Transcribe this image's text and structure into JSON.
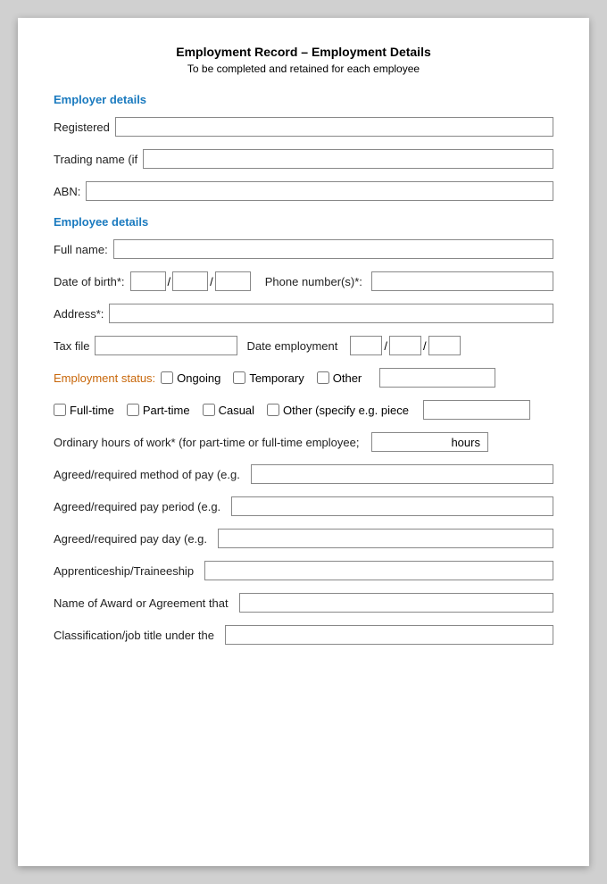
{
  "page": {
    "title": "Employment Record – Employment Details",
    "subtitle": "To be completed and retained for each employee"
  },
  "employer": {
    "heading": "Employer details",
    "registered_label": "Registered",
    "trading_label": "Trading name (if",
    "abn_label": "ABN:"
  },
  "employee": {
    "heading": "Employee details",
    "fullname_label": "Full name:",
    "dob_label": "Date of birth*:",
    "phone_label": "Phone number(s)*:",
    "address_label": "Address*:",
    "tax_label": "Tax file",
    "date_emp_label": "Date employment",
    "emp_status_label": "Employment status:",
    "ongoing_label": "Ongoing",
    "temporary_label": "Temporary",
    "other_status_label": "Other",
    "fulltime_label": "Full-time",
    "parttime_label": "Part-time",
    "casual_label": "Casual",
    "other_type_label": "Other (specify e.g. piece",
    "hours_label": "Ordinary hours of work* (for part-time or full-time employee;",
    "hours_unit": "hours",
    "pay_method_label": "Agreed/required method of pay (e.g.",
    "pay_period_label": "Agreed/required pay period (e.g.",
    "pay_day_label": "Agreed/required pay day (e.g.",
    "apprenticeship_label": "Apprenticeship/Traineeship",
    "award_label": "Name of Award or Agreement that",
    "classification_label": "Classification/job title under the"
  }
}
